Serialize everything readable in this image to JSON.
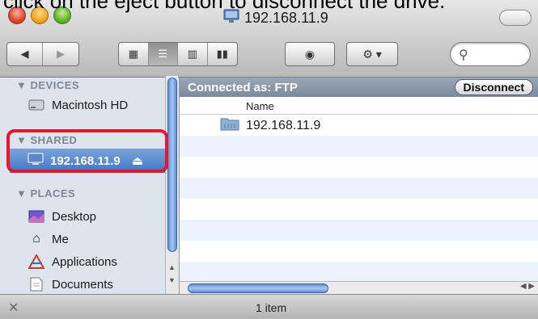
{
  "caption": "click on the eject button to disconnect the drive.",
  "window": {
    "title": "192.168.11.9"
  },
  "toolbar": {
    "back_icon": "◀",
    "forward_icon": "▶",
    "search_placeholder": ""
  },
  "sidebar": {
    "devices_header": "▼ DEVICES",
    "devices": [
      {
        "label": "Macintosh HD",
        "icon": "harddrive-icon"
      }
    ],
    "shared_header": "▼ SHARED",
    "shared": [
      {
        "label": "192.168.11.9",
        "icon": "server-icon"
      }
    ],
    "places_header": "▼ PLACES",
    "places": [
      {
        "label": "Desktop",
        "icon": "desktop-icon"
      },
      {
        "label": "Me",
        "icon": "home-icon"
      },
      {
        "label": "Applications",
        "icon": "applications-icon"
      },
      {
        "label": "Documents",
        "icon": "documents-icon"
      }
    ]
  },
  "content": {
    "connected_label": "Connected as: FTP",
    "disconnect_label": "Disconnect",
    "column_name": "Name",
    "files": [
      {
        "name": "192.168.11.9",
        "icon": "network-folder-icon"
      }
    ]
  },
  "status": {
    "count": "1 item"
  },
  "colors": {
    "selection": "#3f76c8",
    "highlight_box": "#e8162a",
    "sidebar_bg": "#dde4ec"
  }
}
